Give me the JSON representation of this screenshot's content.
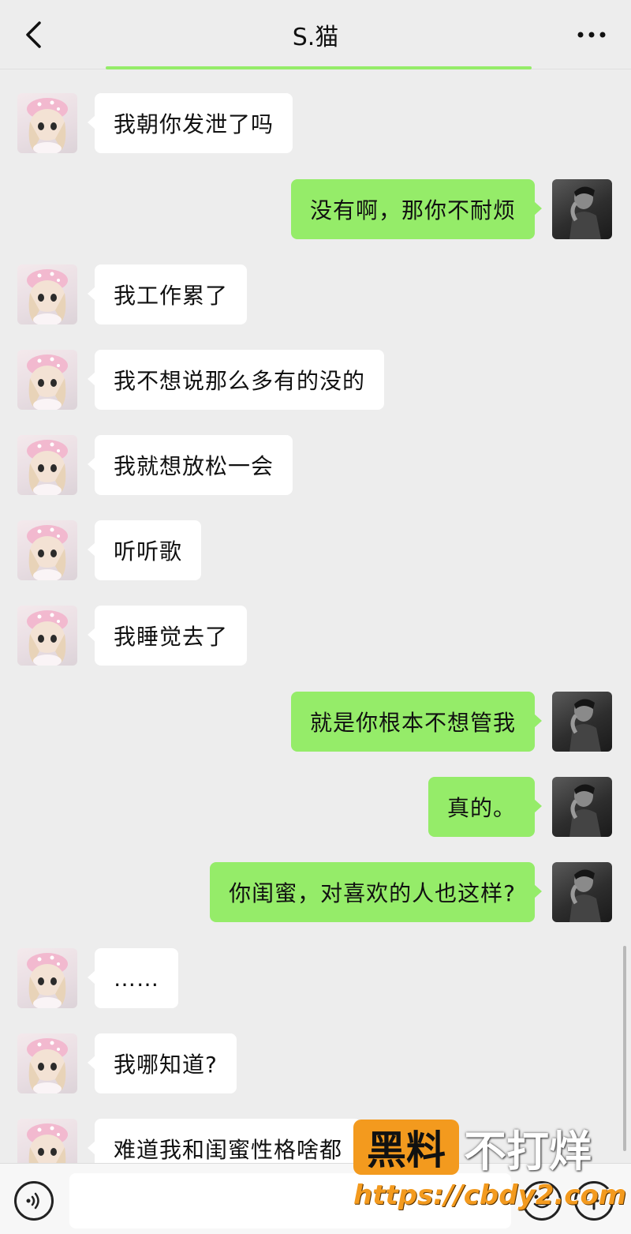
{
  "header": {
    "title": "S.猫",
    "back_icon": "chevron-left-icon",
    "more_icon": "more-dots-icon"
  },
  "messages": [
    {
      "side": "left",
      "text": "我朝你发泄了吗"
    },
    {
      "side": "right",
      "text": "没有啊，那你不耐烦"
    },
    {
      "side": "left",
      "text": "我工作累了"
    },
    {
      "side": "left",
      "text": "我不想说那么多有的没的"
    },
    {
      "side": "left",
      "text": "我就想放松一会"
    },
    {
      "side": "left",
      "text": "听听歌"
    },
    {
      "side": "left",
      "text": "我睡觉去了"
    },
    {
      "side": "right",
      "text": "就是你根本不想管我"
    },
    {
      "side": "right",
      "text": "真的。"
    },
    {
      "side": "right",
      "text": "你闺蜜，对喜欢的人也这样?"
    },
    {
      "side": "left",
      "text": "……"
    },
    {
      "side": "left",
      "text": "我哪知道?"
    },
    {
      "side": "left",
      "text": "难道我和闺蜜性格啥都"
    }
  ],
  "input_bar": {
    "voice_icon": "voice-icon",
    "emoji_icon": "emoji-icon",
    "plus_icon": "plus-icon",
    "value": ""
  },
  "watermark": {
    "badge": "黑料",
    "text": "不打烊",
    "url": "https://cbdy2.com"
  },
  "colors": {
    "background": "#ededed",
    "sent_bubble": "#95ec69",
    "received_bubble": "#ffffff",
    "watermark_accent": "#f39a1e"
  }
}
